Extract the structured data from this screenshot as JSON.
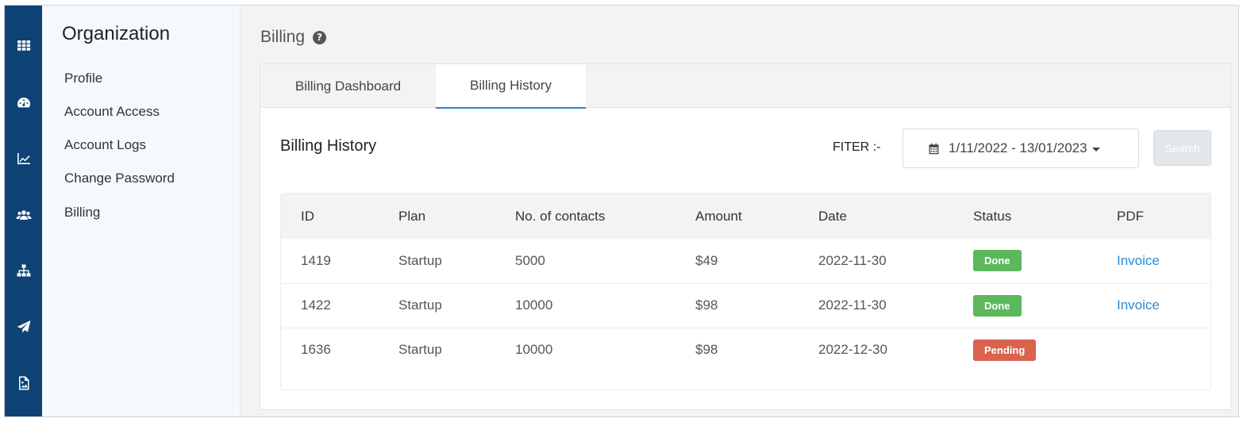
{
  "rail": {
    "icons": [
      "grid-icon",
      "dashboard-icon",
      "chart-line-icon",
      "users-icon",
      "sitemap-icon",
      "paper-plane-icon",
      "image-file-icon"
    ]
  },
  "subnav": {
    "title": "Organization",
    "items": [
      {
        "label": "Profile"
      },
      {
        "label": "Account Access"
      },
      {
        "label": "Account Logs"
      },
      {
        "label": "Change Password"
      },
      {
        "label": "Billing"
      }
    ]
  },
  "header": {
    "title": "Billing",
    "help_glyph": "?"
  },
  "tabs": [
    {
      "label": "Billing Dashboard",
      "active": false
    },
    {
      "label": "Billing History",
      "active": true
    }
  ],
  "history": {
    "title": "Billing History",
    "filter_label": "FITER :-",
    "date_range": "1/11/2022 - 13/01/2023",
    "search_label": "Search",
    "columns": [
      "ID",
      "Plan",
      "No. of contacts",
      "Amount",
      "Date",
      "Status",
      "PDF"
    ],
    "rows": [
      {
        "id": "1419",
        "plan": "Startup",
        "contacts": "5000",
        "amount": "$49",
        "date": "2022-11-30",
        "status": "Done",
        "pdf": "Invoice"
      },
      {
        "id": "1422",
        "plan": "Startup",
        "contacts": "10000",
        "amount": "$98",
        "date": "2022-11-30",
        "status": "Done",
        "pdf": "Invoice"
      },
      {
        "id": "1636",
        "plan": "Startup",
        "contacts": "10000",
        "amount": "$98",
        "date": "2022-12-30",
        "status": "Pending",
        "pdf": ""
      }
    ]
  },
  "colors": {
    "rail_bg": "#0e4275",
    "accent": "#2a7fd4",
    "done": "#5cb85c",
    "pending": "#d9634f",
    "link": "#2a8bd6"
  }
}
